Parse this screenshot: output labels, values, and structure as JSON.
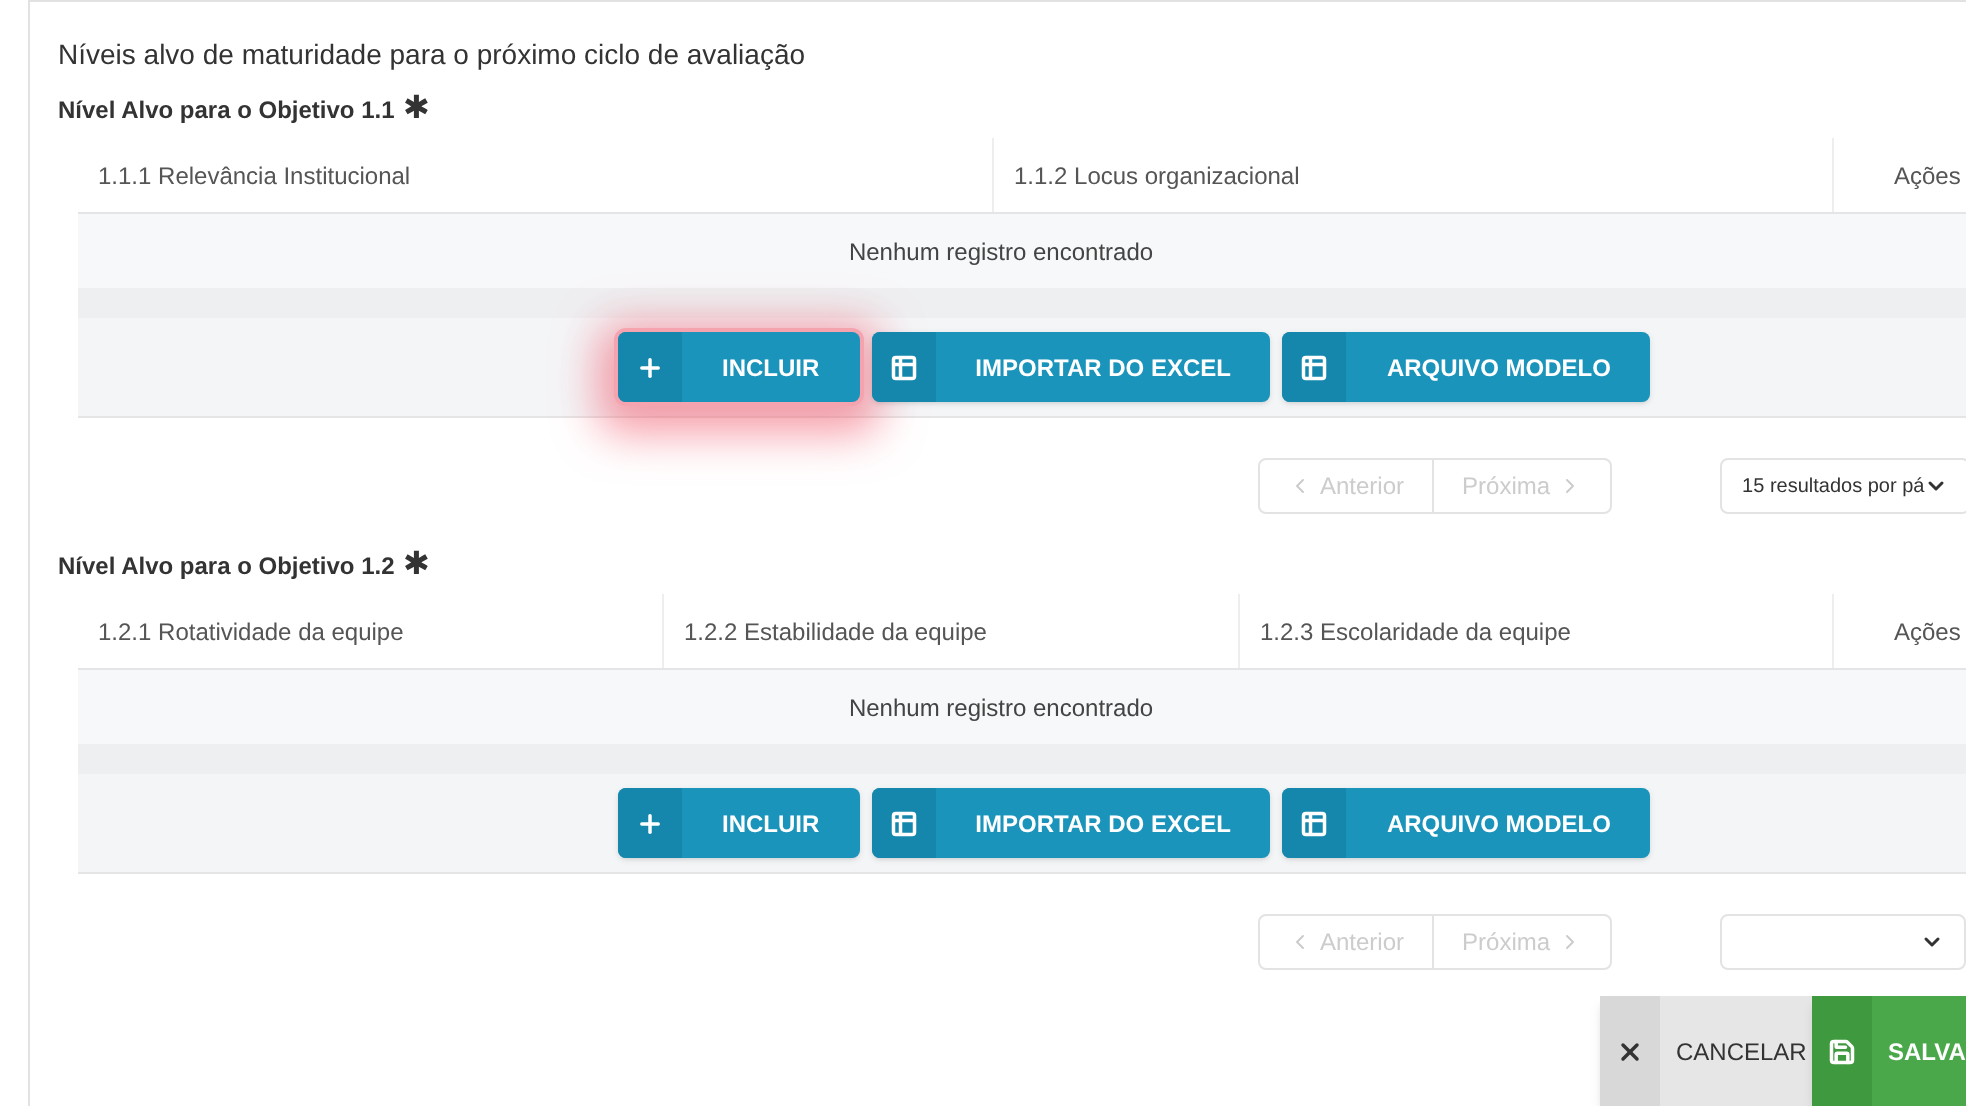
{
  "heading": "Níveis alvo de maturidade para o próximo ciclo de avaliação",
  "sections": [
    {
      "title": "Nível Alvo para o Objetivo 1.1",
      "required_mark": "✱",
      "columns": [
        "1.1.1 Relevância Institucional",
        "1.1.2 Locus organizacional"
      ],
      "actions_header": "Ações",
      "empty_text": "Nenhum registro encontrado",
      "buttons": [
        {
          "label": "INCLUIR",
          "kind": "add",
          "highlighted": true
        },
        {
          "label": "IMPORTAR DO EXCEL",
          "kind": "table",
          "highlighted": false
        },
        {
          "label": "ARQUIVO MODELO",
          "kind": "table",
          "highlighted": false
        }
      ],
      "pagination": {
        "previous": "Anterior",
        "next": "Próxima",
        "disabled": true,
        "page_size": "15 resultados por pá"
      }
    },
    {
      "title": "Nível Alvo para o Objetivo 1.2",
      "required_mark": "✱",
      "columns": [
        "1.2.1 Rotatividade da equipe",
        "1.2.2 Estabilidade da equipe",
        "1.2.3 Escolaridade da equipe"
      ],
      "actions_header": "Ações",
      "empty_text": "Nenhum registro encontrado",
      "buttons": [
        {
          "label": "INCLUIR",
          "kind": "add",
          "highlighted": false
        },
        {
          "label": "IMPORTAR DO EXCEL",
          "kind": "table",
          "highlighted": false
        },
        {
          "label": "ARQUIVO MODELO",
          "kind": "table",
          "highlighted": false
        }
      ],
      "pagination": {
        "previous": "Anterior",
        "next": "Próxima",
        "disabled": true
      }
    }
  ],
  "footer_buttons": [
    {
      "label": "CANCELAR",
      "kind": "cancel"
    },
    {
      "label": "SALVA",
      "kind": "save"
    }
  ]
}
